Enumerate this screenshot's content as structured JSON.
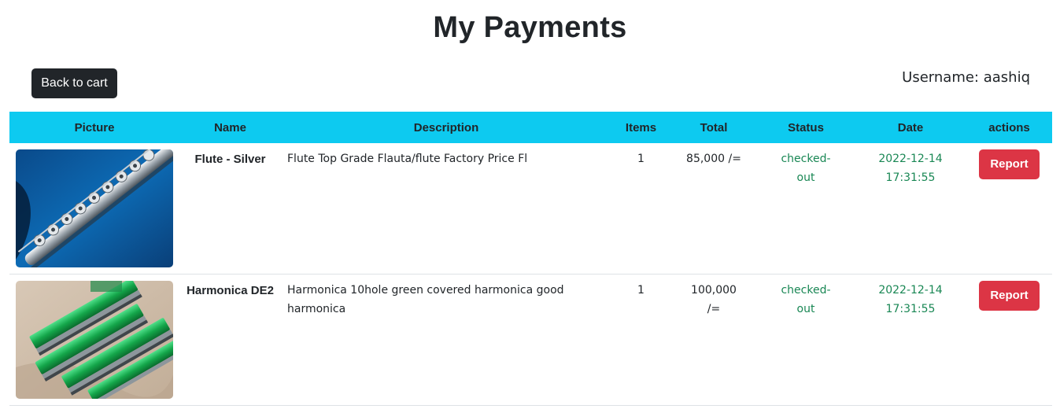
{
  "page": {
    "title": "My Payments",
    "back_button_label": "Back to cart",
    "username_text": "Username: aashiq"
  },
  "table": {
    "headers": [
      "Picture",
      "Name",
      "Description",
      "Items",
      "Total",
      "Status",
      "Date",
      "actions"
    ],
    "rows": [
      {
        "picture": "flute-image",
        "name": "Flute - Silver",
        "description": "Flute Top Grade Flauta/flute Factory Price Fl",
        "items": "1",
        "total": "85,000 /=",
        "status": "checked-out",
        "date": "2022-12-14 17:31:55",
        "action_label": "Report"
      },
      {
        "picture": "harmonica-image",
        "name": "Harmonica DE2",
        "description": "Harmonica 10hole green covered harmonica good harmonica",
        "items": "1",
        "total": "100,000 /=",
        "status": "checked-out",
        "date": "2022-12-14 17:31:55",
        "action_label": "Report"
      }
    ]
  },
  "colors": {
    "header_bg": "#0dcaf0",
    "status_green": "#198754",
    "report_red": "#dc3545",
    "dark_button": "#212529"
  }
}
